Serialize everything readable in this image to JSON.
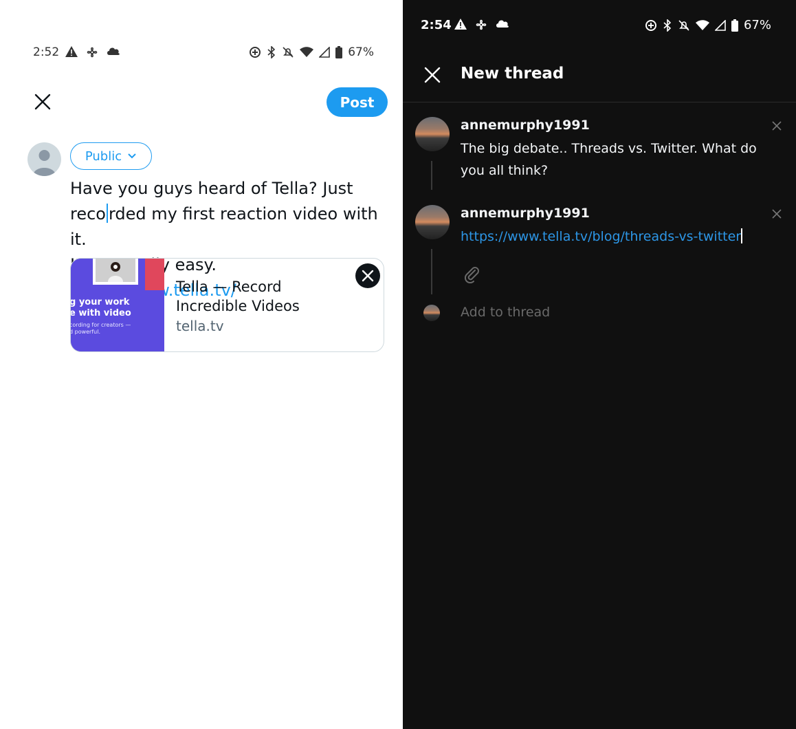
{
  "left": {
    "status": {
      "time": "2:52",
      "battery": "67%"
    },
    "post_label": "Post",
    "audience_label": "Public",
    "tweet": {
      "line1": "Have you guys heard of Tella? Just",
      "line2_a": "reco",
      "line2_b": "rded my first reaction video with it.",
      "line3": "It was really easy.",
      "link": "https://www.tella.tv/"
    },
    "card": {
      "title": "Tella — Record Incredible Videos",
      "domain": "tella.tv",
      "thumb_line1": "g your work",
      "thumb_line2": "e with video",
      "thumb_line3": "cording for creators —",
      "thumb_line4": "d powerful."
    }
  },
  "right": {
    "status": {
      "time": "2:54",
      "battery": "67%"
    },
    "title": "New thread",
    "posts": [
      {
        "username": "annemurphy1991",
        "text": "The big debate.. Threads vs. Twitter. What do you all think?"
      },
      {
        "username": "annemurphy1991",
        "link": "https://www.tella.tv/blog/threads-vs-twitter"
      }
    ],
    "add_to_thread": "Add to thread"
  },
  "colors": {
    "twitter_blue": "#1d9bf0",
    "threads_bg": "#101010",
    "threads_link": "#2d96e6"
  },
  "icons": [
    "close-icon",
    "chevron-down-icon",
    "person-icon",
    "paperclip-icon",
    "warning-icon",
    "cloud-icon",
    "bluetooth-icon",
    "wifi-icon",
    "battery-icon"
  ]
}
